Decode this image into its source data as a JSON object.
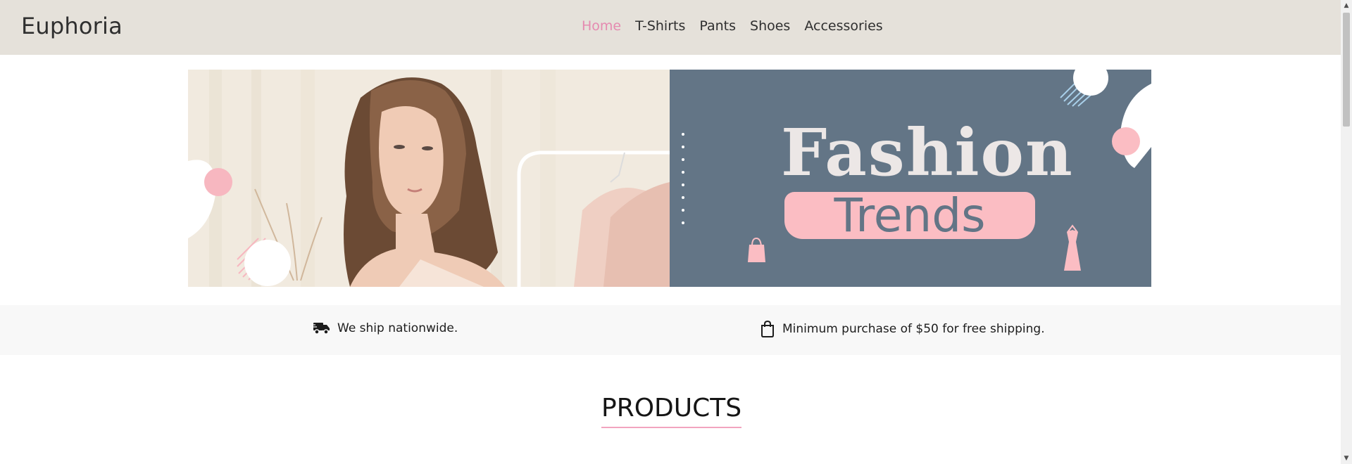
{
  "brand": "Euphoria",
  "nav": {
    "items": [
      {
        "label": "Home",
        "active": true
      },
      {
        "label": "T-Shirts",
        "active": false
      },
      {
        "label": "Pants",
        "active": false
      },
      {
        "label": "Shoes",
        "active": false
      },
      {
        "label": "Accessories",
        "active": false
      }
    ]
  },
  "banner": {
    "headline": "Fashion",
    "subheadline": "Trends"
  },
  "info": {
    "shipping": "We ship nationwide.",
    "minimum": "Minimum purchase of $50 for free shipping."
  },
  "products": {
    "title": "PRODUCTS"
  },
  "colors": {
    "navbar_bg": "#e5e1da",
    "accent_pink": "#e58ab0",
    "banner_panel": "#637586",
    "pill_pink": "#fbbdc3"
  },
  "icons": {
    "shipping": "truck-icon",
    "minimum": "shopping-bag-icon"
  }
}
